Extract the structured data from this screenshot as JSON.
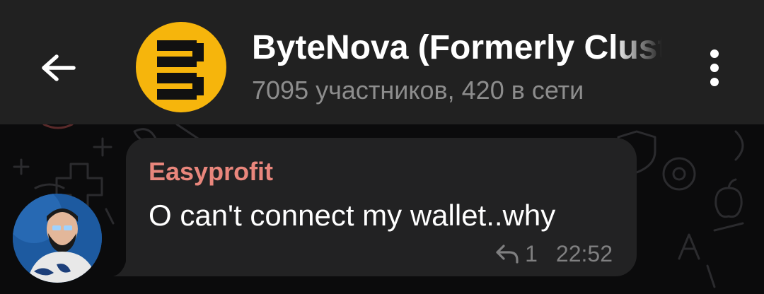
{
  "header": {
    "title": "ByteNova (Formerly Cluster)",
    "subtitle": "7095 участников, 420 в сети",
    "back_icon": "arrow-left-icon",
    "menu_icon": "more-vertical-icon",
    "avatar_color": "#f6b50c"
  },
  "message": {
    "sender": "Easyprofit",
    "sender_color": "#e9867c",
    "text": "O can't connect my wallet..why",
    "reply_count": "1",
    "time": "22:52"
  },
  "colors": {
    "header_bg": "#212121",
    "chat_bg": "#0b0b0c",
    "bubble_bg": "#222223"
  }
}
